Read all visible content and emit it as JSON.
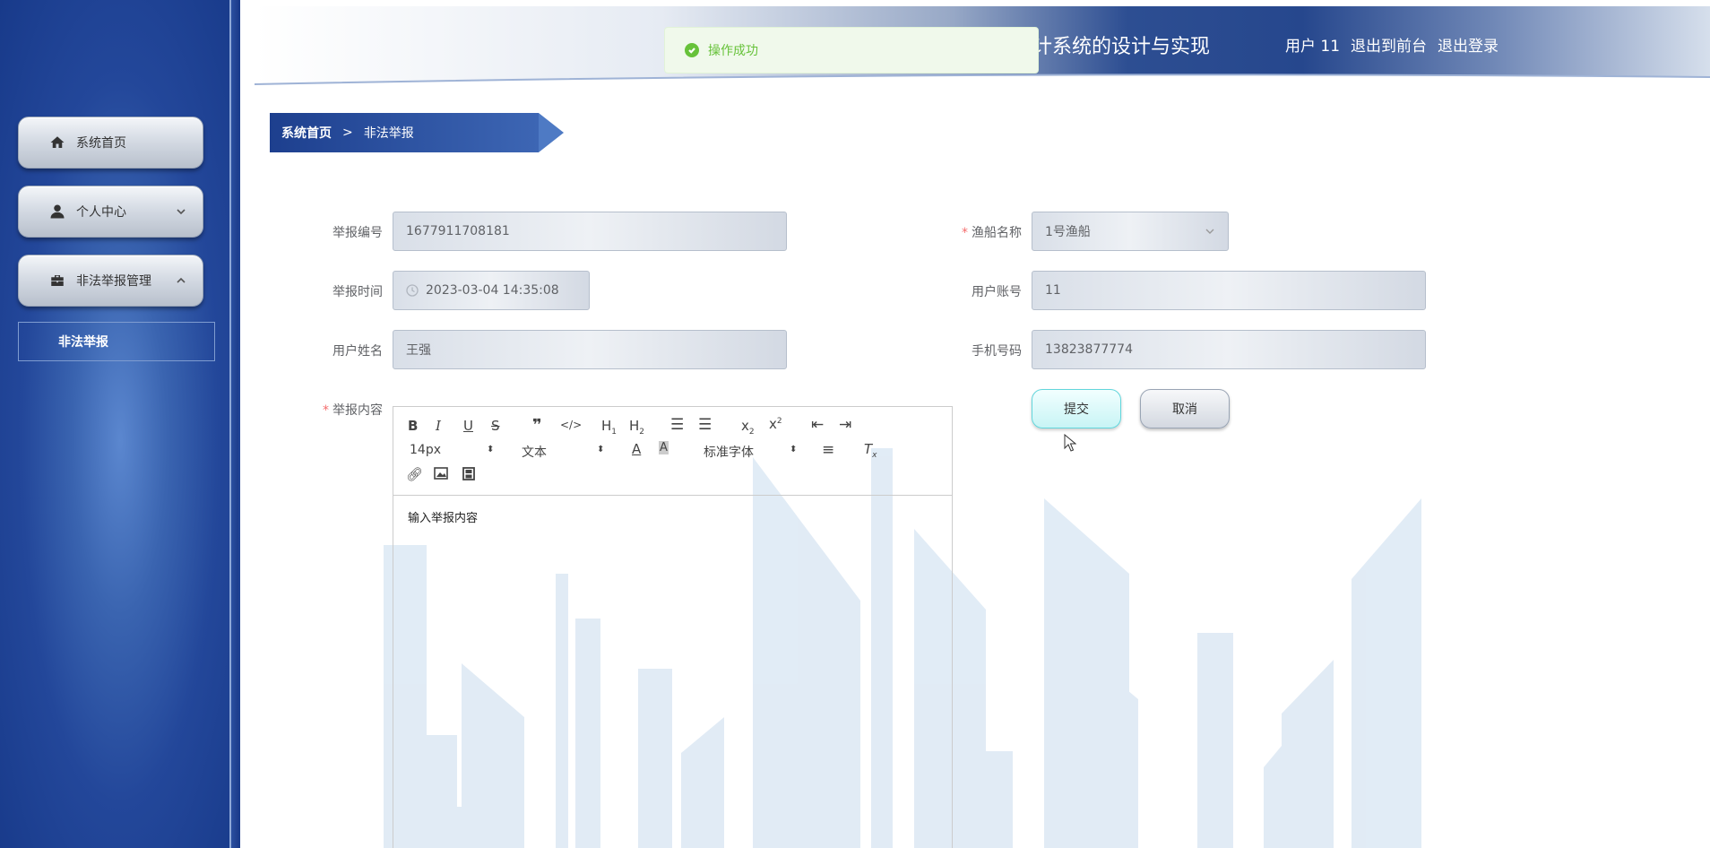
{
  "header": {
    "title": "计系统的设计与实现",
    "user": "用户 11",
    "links": [
      "退出到前台",
      "退出登录"
    ]
  },
  "toast": {
    "message": "操作成功"
  },
  "sidebar": {
    "items": [
      {
        "label": "系统首页",
        "icon": "home-icon"
      },
      {
        "label": "个人中心",
        "icon": "user-icon",
        "chevron": "chevron-down-icon"
      },
      {
        "label": "非法举报管理",
        "icon": "briefcase-icon",
        "chevron": "chevron-up-icon"
      }
    ],
    "sub_item": "非法举报"
  },
  "breadcrumb": {
    "home": "系统首页",
    "separator": ">",
    "current": "非法举报"
  },
  "form": {
    "report_no": {
      "label": "举报编号",
      "value": "1677911708181"
    },
    "report_time": {
      "label": "举报时间",
      "value": "2023-03-04 14:35:08"
    },
    "user_name": {
      "label": "用户姓名",
      "value": "王强"
    },
    "content": {
      "label": "举报内容",
      "placeholder": "输入举报内容"
    },
    "boat_name": {
      "label": "渔船名称",
      "value": "1号渔船"
    },
    "account": {
      "label": "用户账号",
      "value": "11"
    },
    "phone": {
      "label": "手机号码",
      "value": "13823877774"
    },
    "submit": "提交",
    "cancel": "取消"
  },
  "editor": {
    "font_size": "14px",
    "text_type": "文本",
    "font_family": "标准字体"
  },
  "colors": {
    "accent": "#1d3f8e",
    "success": "#67c23a",
    "required": "#f56c6c"
  }
}
